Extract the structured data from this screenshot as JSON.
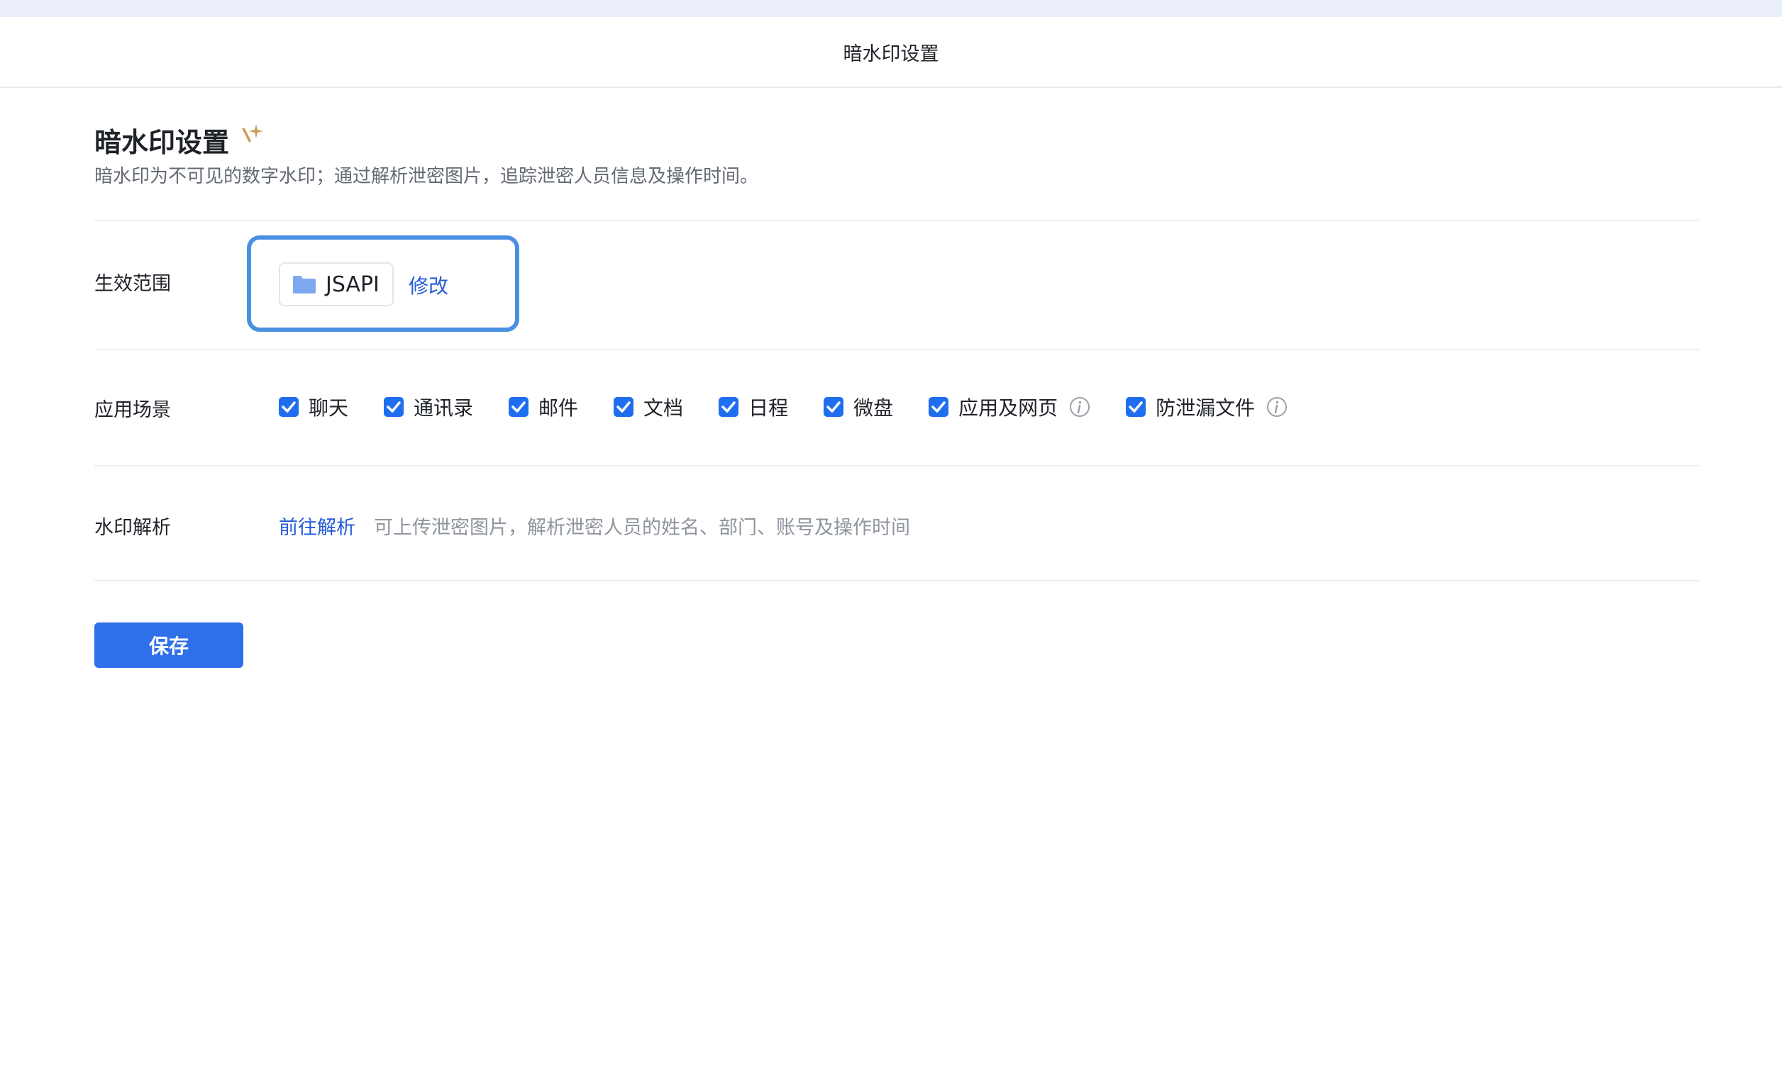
{
  "header": {
    "title": "暗水印设置"
  },
  "page": {
    "title": "暗水印设置",
    "description": "暗水印为不可见的数字水印；通过解析泄密图片，追踪泄密人员信息及操作时间。"
  },
  "scope": {
    "label": "生效范围",
    "tag": "JSAPI",
    "edit": "修改"
  },
  "scenes": {
    "label": "应用场景",
    "items": [
      {
        "label": "聊天",
        "checked": true,
        "info": false
      },
      {
        "label": "通讯录",
        "checked": true,
        "info": false
      },
      {
        "label": "邮件",
        "checked": true,
        "info": false
      },
      {
        "label": "文档",
        "checked": true,
        "info": false
      },
      {
        "label": "日程",
        "checked": true,
        "info": false
      },
      {
        "label": "微盘",
        "checked": true,
        "info": false
      },
      {
        "label": "应用及网页",
        "checked": true,
        "info": true
      },
      {
        "label": "防泄漏文件",
        "checked": true,
        "info": true
      }
    ]
  },
  "parse": {
    "label": "水印解析",
    "link": "前往解析",
    "description": "可上传泄密图片，解析泄密人员的姓名、部门、账号及操作时间"
  },
  "save_label": "保存",
  "colors": {
    "accent": "#2f6fe9",
    "link": "#245bdb",
    "highlight_border": "#4a90e2",
    "sparkle": "#c9a15a"
  }
}
